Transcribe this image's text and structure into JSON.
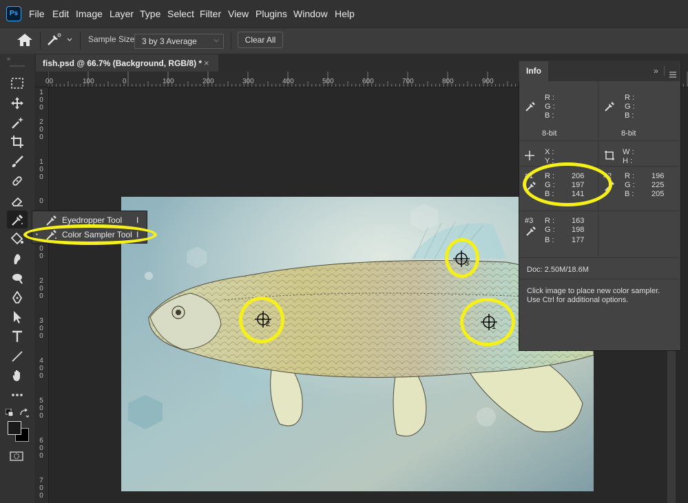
{
  "app": {
    "logo": "Ps"
  },
  "menu": [
    "File",
    "Edit",
    "Image",
    "Layer",
    "Type",
    "Select",
    "Filter",
    "View",
    "Plugins",
    "Window",
    "Help"
  ],
  "options": {
    "sample_size_label": "Sample Size:",
    "sample_size_value": "3 by 3 Average",
    "clear_all": "Clear All"
  },
  "document": {
    "tab_title": "fish.psd @ 66.7% (Background, RGB/8) *",
    "close": "×"
  },
  "rulers": {
    "horizontal": [
      "00",
      "100",
      "0",
      "100",
      "200",
      "300",
      "400",
      "500",
      "600",
      "700",
      "800",
      "900"
    ],
    "vertical": [
      {
        "digits": [
          "1",
          "0",
          "0"
        ]
      },
      {
        "digits": [
          "2",
          "0",
          "0"
        ]
      },
      {
        "digits": [
          "1",
          "0",
          "0"
        ]
      },
      {
        "digits": [
          "0"
        ]
      },
      {
        "digits": [
          "1",
          "0",
          "0"
        ]
      },
      {
        "digits": [
          "2",
          "0",
          "0"
        ]
      },
      {
        "digits": [
          "3",
          "0",
          "0"
        ]
      },
      {
        "digits": [
          "4",
          "0",
          "0"
        ]
      },
      {
        "digits": [
          "5",
          "0",
          "0"
        ]
      },
      {
        "digits": [
          "6",
          "0",
          "0"
        ]
      },
      {
        "digits": [
          "7",
          "0",
          "0"
        ]
      }
    ]
  },
  "flyout": {
    "items": [
      {
        "label": "Eyedropper Tool",
        "shortcut": "I"
      },
      {
        "label": "Color Sampler Tool",
        "shortcut": "I"
      }
    ]
  },
  "samplers": [
    {
      "num": "2"
    },
    {
      "num": "3"
    },
    {
      "num": "1"
    }
  ],
  "info": {
    "tab": "Info",
    "top_left": {
      "r": "R :",
      "g": "G :",
      "b": "B :",
      "bits": "8-bit"
    },
    "top_right": {
      "r": "R :",
      "g": "G :",
      "b": "B :",
      "bits": "8-bit"
    },
    "xy": {
      "x": "X :",
      "y": "Y :"
    },
    "wh": {
      "w": "W :",
      "h": "H :"
    },
    "s1": {
      "num": "#1",
      "r": "R :",
      "g": "G :",
      "b": "B :",
      "rv": "206",
      "gv": "197",
      "bv": "141"
    },
    "s2": {
      "num": "#2",
      "r": "R :",
      "g": "G :",
      "b": "B :",
      "rv": "196",
      "gv": "225",
      "bv": "205"
    },
    "s3": {
      "num": "#3",
      "r": "R :",
      "g": "G :",
      "b": "B :",
      "rv": "163",
      "gv": "198",
      "bv": "177"
    },
    "doc": "Doc: 2.50M/18.6M",
    "hint1": "Click image to place new color sampler.",
    "hint2": "Use Ctrl for additional options."
  },
  "highlight_color": "#f5f01a"
}
